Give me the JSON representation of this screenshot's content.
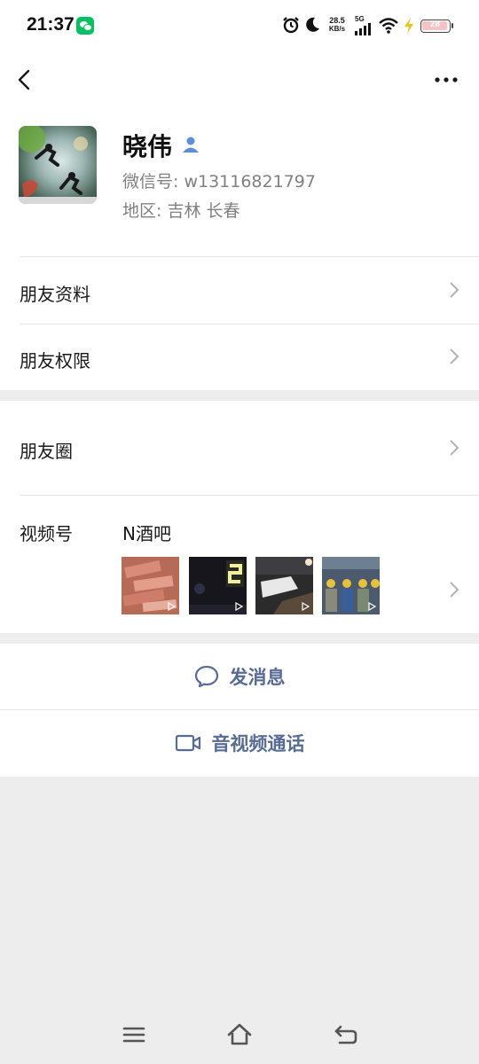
{
  "status_bar": {
    "time": "21:37",
    "net_speed_value": "28.5",
    "net_speed_unit": "KB/s",
    "network": "5G",
    "battery": "28",
    "icons": [
      "wechat-notification-icon",
      "alarm-icon",
      "moon-icon",
      "signal-icon",
      "wifi-icon",
      "charging-icon",
      "battery-icon"
    ]
  },
  "header": {
    "back_icon": "chevron-left-icon",
    "more_icon": "more-dots-icon"
  },
  "profile": {
    "nickname": "晓伟",
    "badge_icon": "person-icon",
    "wechat_id": "微信号:  w13116821797",
    "region": "地区:  吉林  长春"
  },
  "menu": {
    "friend_info": "朋友资料",
    "friend_permissions": "朋友权限",
    "moments": "朋友圈",
    "channels": "视频号",
    "channel_name": "N酒吧"
  },
  "channel_thumbnails": [
    "money-stack-thumbnail",
    "night-lights-thumbnail",
    "street-scene-thumbnail",
    "workers-group-thumbnail"
  ],
  "actions": {
    "send_message": "发消息",
    "call": "音视频通话"
  },
  "colors": {
    "link_blue": "#576b95",
    "page_bg": "#ededed",
    "card_bg": "#ffffff",
    "badge_blue": "#5b8fd8",
    "wechat_green": "#07c160"
  },
  "nav": {
    "icons": [
      "menu-icon",
      "home-icon",
      "back-icon"
    ]
  }
}
